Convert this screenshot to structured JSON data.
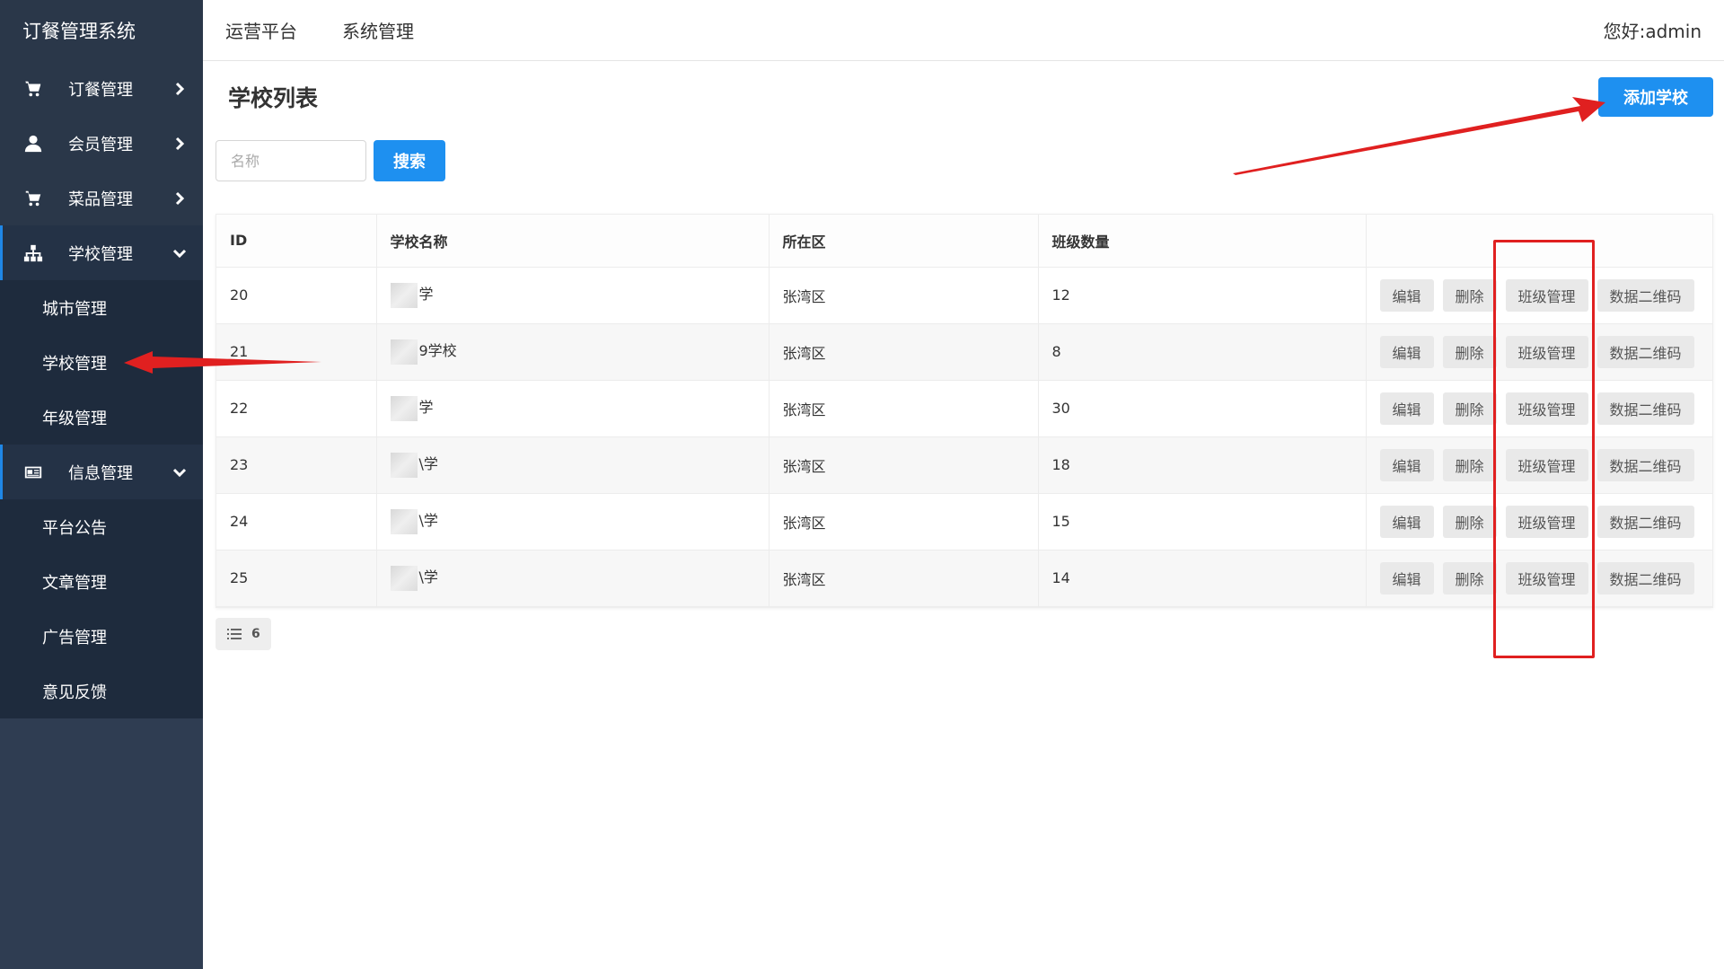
{
  "app": {
    "title": "订餐管理系统"
  },
  "sidebar": {
    "items": [
      {
        "label": "订餐管理",
        "icon": "cart-icon",
        "expanded": false
      },
      {
        "label": "会员管理",
        "icon": "user-icon",
        "expanded": false
      },
      {
        "label": "菜品管理",
        "icon": "cart-icon",
        "expanded": false
      },
      {
        "label": "学校管理",
        "icon": "sitemap-icon",
        "expanded": true,
        "children": [
          {
            "label": "城市管理"
          },
          {
            "label": "学校管理"
          },
          {
            "label": "年级管理"
          }
        ]
      },
      {
        "label": "信息管理",
        "icon": "news-icon",
        "expanded": true,
        "children": [
          {
            "label": "平台公告"
          },
          {
            "label": "文章管理"
          },
          {
            "label": "广告管理"
          },
          {
            "label": "意见反馈"
          }
        ]
      }
    ]
  },
  "topbar": {
    "nav": [
      {
        "label": "运营平台"
      },
      {
        "label": "系统管理"
      }
    ],
    "greeting": "您好:admin"
  },
  "page": {
    "title": "学校列表",
    "add_label": "添加学校",
    "search": {
      "placeholder": "名称",
      "value": "",
      "button_label": "搜索"
    }
  },
  "table": {
    "columns": [
      "ID",
      "学校名称",
      "所在区",
      "班级数量",
      ""
    ],
    "rows": [
      {
        "id": "20",
        "name": "学",
        "district": "张湾区",
        "classes": "12"
      },
      {
        "id": "21",
        "name": "9学校",
        "district": "张湾区",
        "classes": "8"
      },
      {
        "id": "22",
        "name": "学",
        "district": "张湾区",
        "classes": "30"
      },
      {
        "id": "23",
        "name": "\\学",
        "district": "张湾区",
        "classes": "18"
      },
      {
        "id": "24",
        "name": "\\学",
        "district": "张湾区",
        "classes": "15"
      },
      {
        "id": "25",
        "name": "\\学",
        "district": "张湾区",
        "classes": "14"
      }
    ],
    "actions": {
      "edit": "编辑",
      "delete": "删除",
      "classes": "班级管理",
      "qrcode": "数据二维码"
    }
  },
  "pager": {
    "total": "6"
  },
  "colors": {
    "sidebar_bg": "#2f3d52",
    "primary": "#1e90f0",
    "annotation": "#e02020"
  }
}
